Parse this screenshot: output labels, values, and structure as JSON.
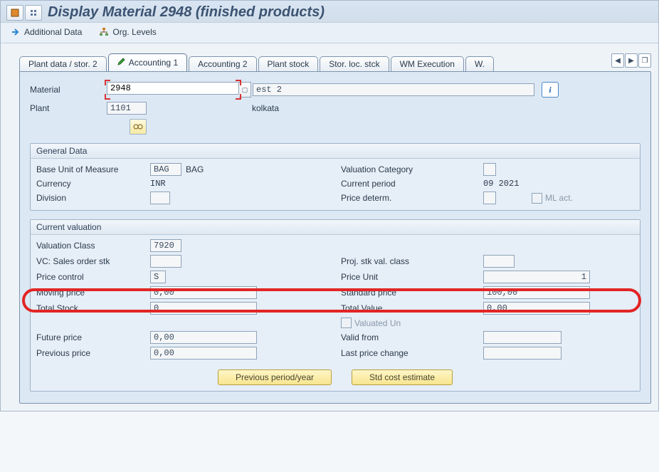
{
  "header": {
    "title": "Display Material 2948 (finished products)",
    "icons": [
      "tx-icon",
      "detail-icon"
    ]
  },
  "toolbar": {
    "additional_data": "Additional Data",
    "org_levels": "Org. Levels"
  },
  "tabs": {
    "items": [
      {
        "label": "Plant data / stor. 2"
      },
      {
        "label": "Accounting 1",
        "active": true
      },
      {
        "label": "Accounting 2"
      },
      {
        "label": "Plant stock"
      },
      {
        "label": "Stor. loc. stck"
      },
      {
        "label": "WM Execution"
      },
      {
        "label": "W."
      }
    ]
  },
  "keyfields": {
    "material_label": "Material",
    "material_value": "2948",
    "material_text": "est 2",
    "plant_label": "Plant",
    "plant_value": "1101",
    "plant_text": "kolkata"
  },
  "general": {
    "title": "General Data",
    "buom_label": "Base Unit of Measure",
    "buom": "BAG",
    "buom_text": "BAG",
    "valcat_label": "Valuation Category",
    "valcat": "",
    "currency_label": "Currency",
    "currency": "INR",
    "period_label": "Current period",
    "period": "09 2021",
    "division_label": "Division",
    "division": "",
    "pricedet_label": "Price determ.",
    "pricedet": "",
    "mlact_label": "ML act."
  },
  "valuation": {
    "title": "Current valuation",
    "valclass_label": "Valuation Class",
    "valclass": "7920",
    "vcso_label": "VC: Sales order stk",
    "vcso": "",
    "proj_label": "Proj. stk val. class",
    "proj": "",
    "pricectrl_label": "Price control",
    "pricectrl": "S",
    "priceunit_label": "Price Unit",
    "priceunit": "1",
    "moving_label": "Moving price",
    "moving": "0,00",
    "std_label": "Standard price",
    "std": "100,00",
    "totstock_label": "Total Stock",
    "totstock": "0",
    "totvalue_label": "Total Value",
    "totvalue": "0,00",
    "valun_label": "Valuated Un",
    "future_label": "Future price",
    "future": "0,00",
    "validfrom_label": "Valid from",
    "validfrom": "",
    "prev_label": "Previous price",
    "prev": "0,00",
    "lastchg_label": "Last price change",
    "lastchg": ""
  },
  "buttons": {
    "prev_period": "Previous period/year",
    "std_cost": "Std cost estimate"
  }
}
